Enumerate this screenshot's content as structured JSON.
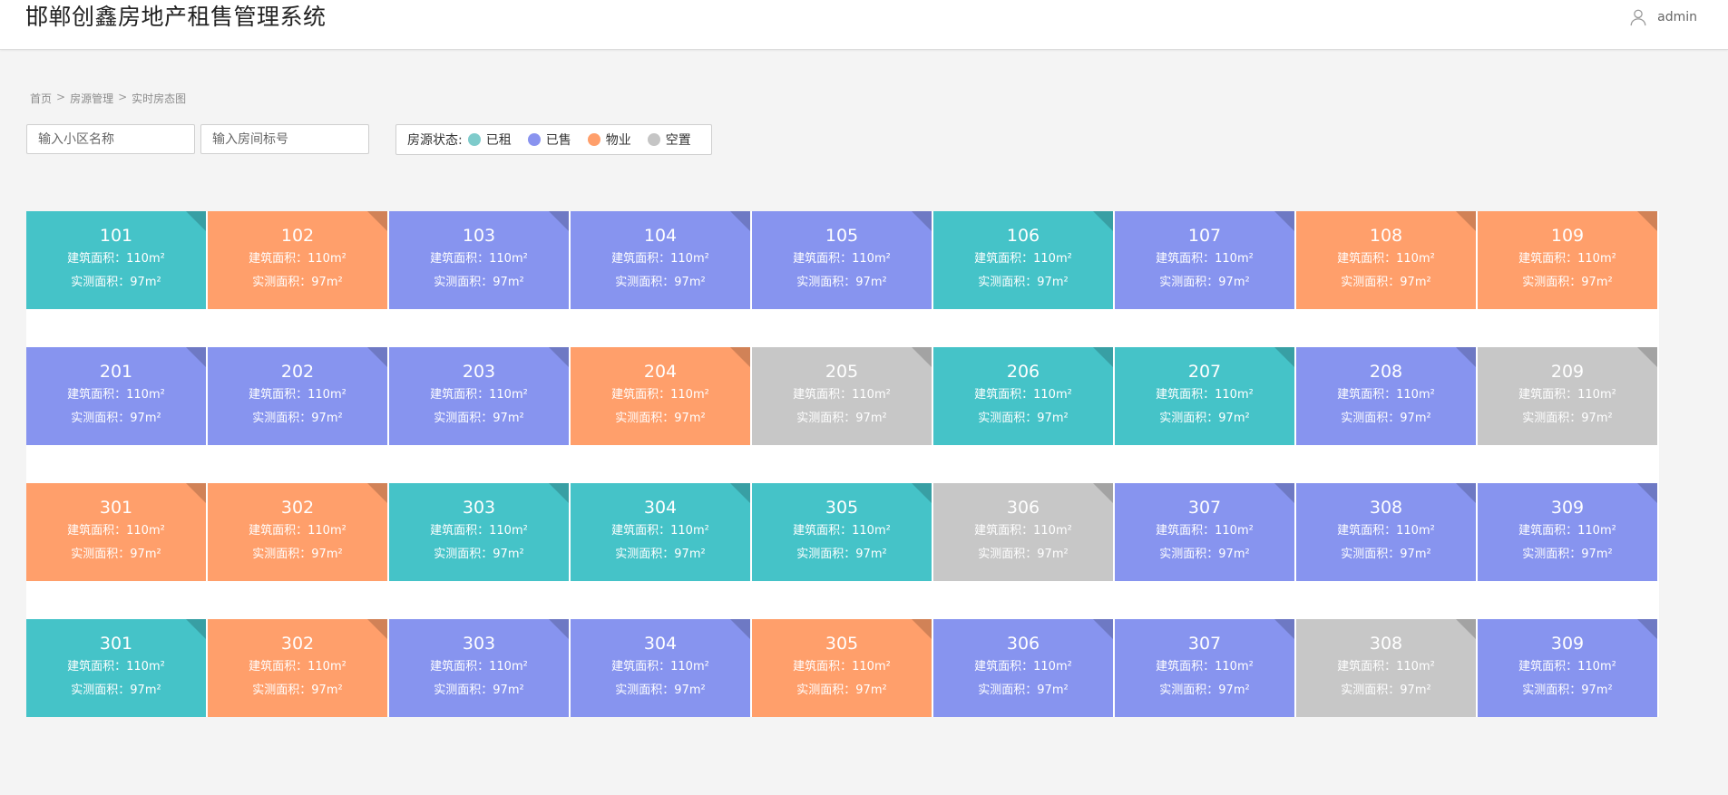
{
  "header": {
    "title": "邯郸创鑫房地产租售管理系统",
    "user": "admin",
    "user_icon": "user-icon"
  },
  "breadcrumb": [
    "首页",
    "房源管理",
    "实时房态图"
  ],
  "breadcrumb_separator": ">",
  "filters": {
    "community_placeholder": "输入小区名称",
    "room_placeholder": "输入房间标号"
  },
  "legend": {
    "label": "房源状态:",
    "items": [
      {
        "label": "已租",
        "color": "#7ecbcb"
      },
      {
        "label": "已售",
        "color": "#8993ef"
      },
      {
        "label": "物业",
        "color": "#ff9f6b"
      },
      {
        "label": "空置",
        "color": "#c5c5c5"
      }
    ]
  },
  "status_colors": {
    "rented": "#45c3c8",
    "sold": "#8794ef",
    "property": "#ff9f6b",
    "vacant": "#c7c7c7"
  },
  "area_labels": {
    "building": "建筑面积：110m²",
    "measured": "实测面积：97m²"
  },
  "floors": [
    {
      "units": [
        {
          "no": "101",
          "status": "rented"
        },
        {
          "no": "102",
          "status": "property"
        },
        {
          "no": "103",
          "status": "sold"
        },
        {
          "no": "104",
          "status": "sold"
        },
        {
          "no": "105",
          "status": "sold"
        },
        {
          "no": "106",
          "status": "rented"
        },
        {
          "no": "107",
          "status": "sold"
        },
        {
          "no": "108",
          "status": "property"
        },
        {
          "no": "109",
          "status": "property"
        }
      ]
    },
    {
      "units": [
        {
          "no": "201",
          "status": "sold"
        },
        {
          "no": "202",
          "status": "sold"
        },
        {
          "no": "203",
          "status": "sold"
        },
        {
          "no": "204",
          "status": "property"
        },
        {
          "no": "205",
          "status": "vacant"
        },
        {
          "no": "206",
          "status": "rented"
        },
        {
          "no": "207",
          "status": "rented"
        },
        {
          "no": "208",
          "status": "sold"
        },
        {
          "no": "209",
          "status": "vacant"
        }
      ]
    },
    {
      "units": [
        {
          "no": "301",
          "status": "property"
        },
        {
          "no": "302",
          "status": "property"
        },
        {
          "no": "303",
          "status": "rented"
        },
        {
          "no": "304",
          "status": "rented"
        },
        {
          "no": "305",
          "status": "rented"
        },
        {
          "no": "306",
          "status": "vacant"
        },
        {
          "no": "307",
          "status": "sold"
        },
        {
          "no": "308",
          "status": "sold"
        },
        {
          "no": "309",
          "status": "sold"
        }
      ]
    },
    {
      "units": [
        {
          "no": "301",
          "status": "rented"
        },
        {
          "no": "302",
          "status": "property"
        },
        {
          "no": "303",
          "status": "sold"
        },
        {
          "no": "304",
          "status": "sold"
        },
        {
          "no": "305",
          "status": "property"
        },
        {
          "no": "306",
          "status": "sold"
        },
        {
          "no": "307",
          "status": "sold"
        },
        {
          "no": "308",
          "status": "vacant"
        },
        {
          "no": "309",
          "status": "sold"
        }
      ]
    }
  ]
}
